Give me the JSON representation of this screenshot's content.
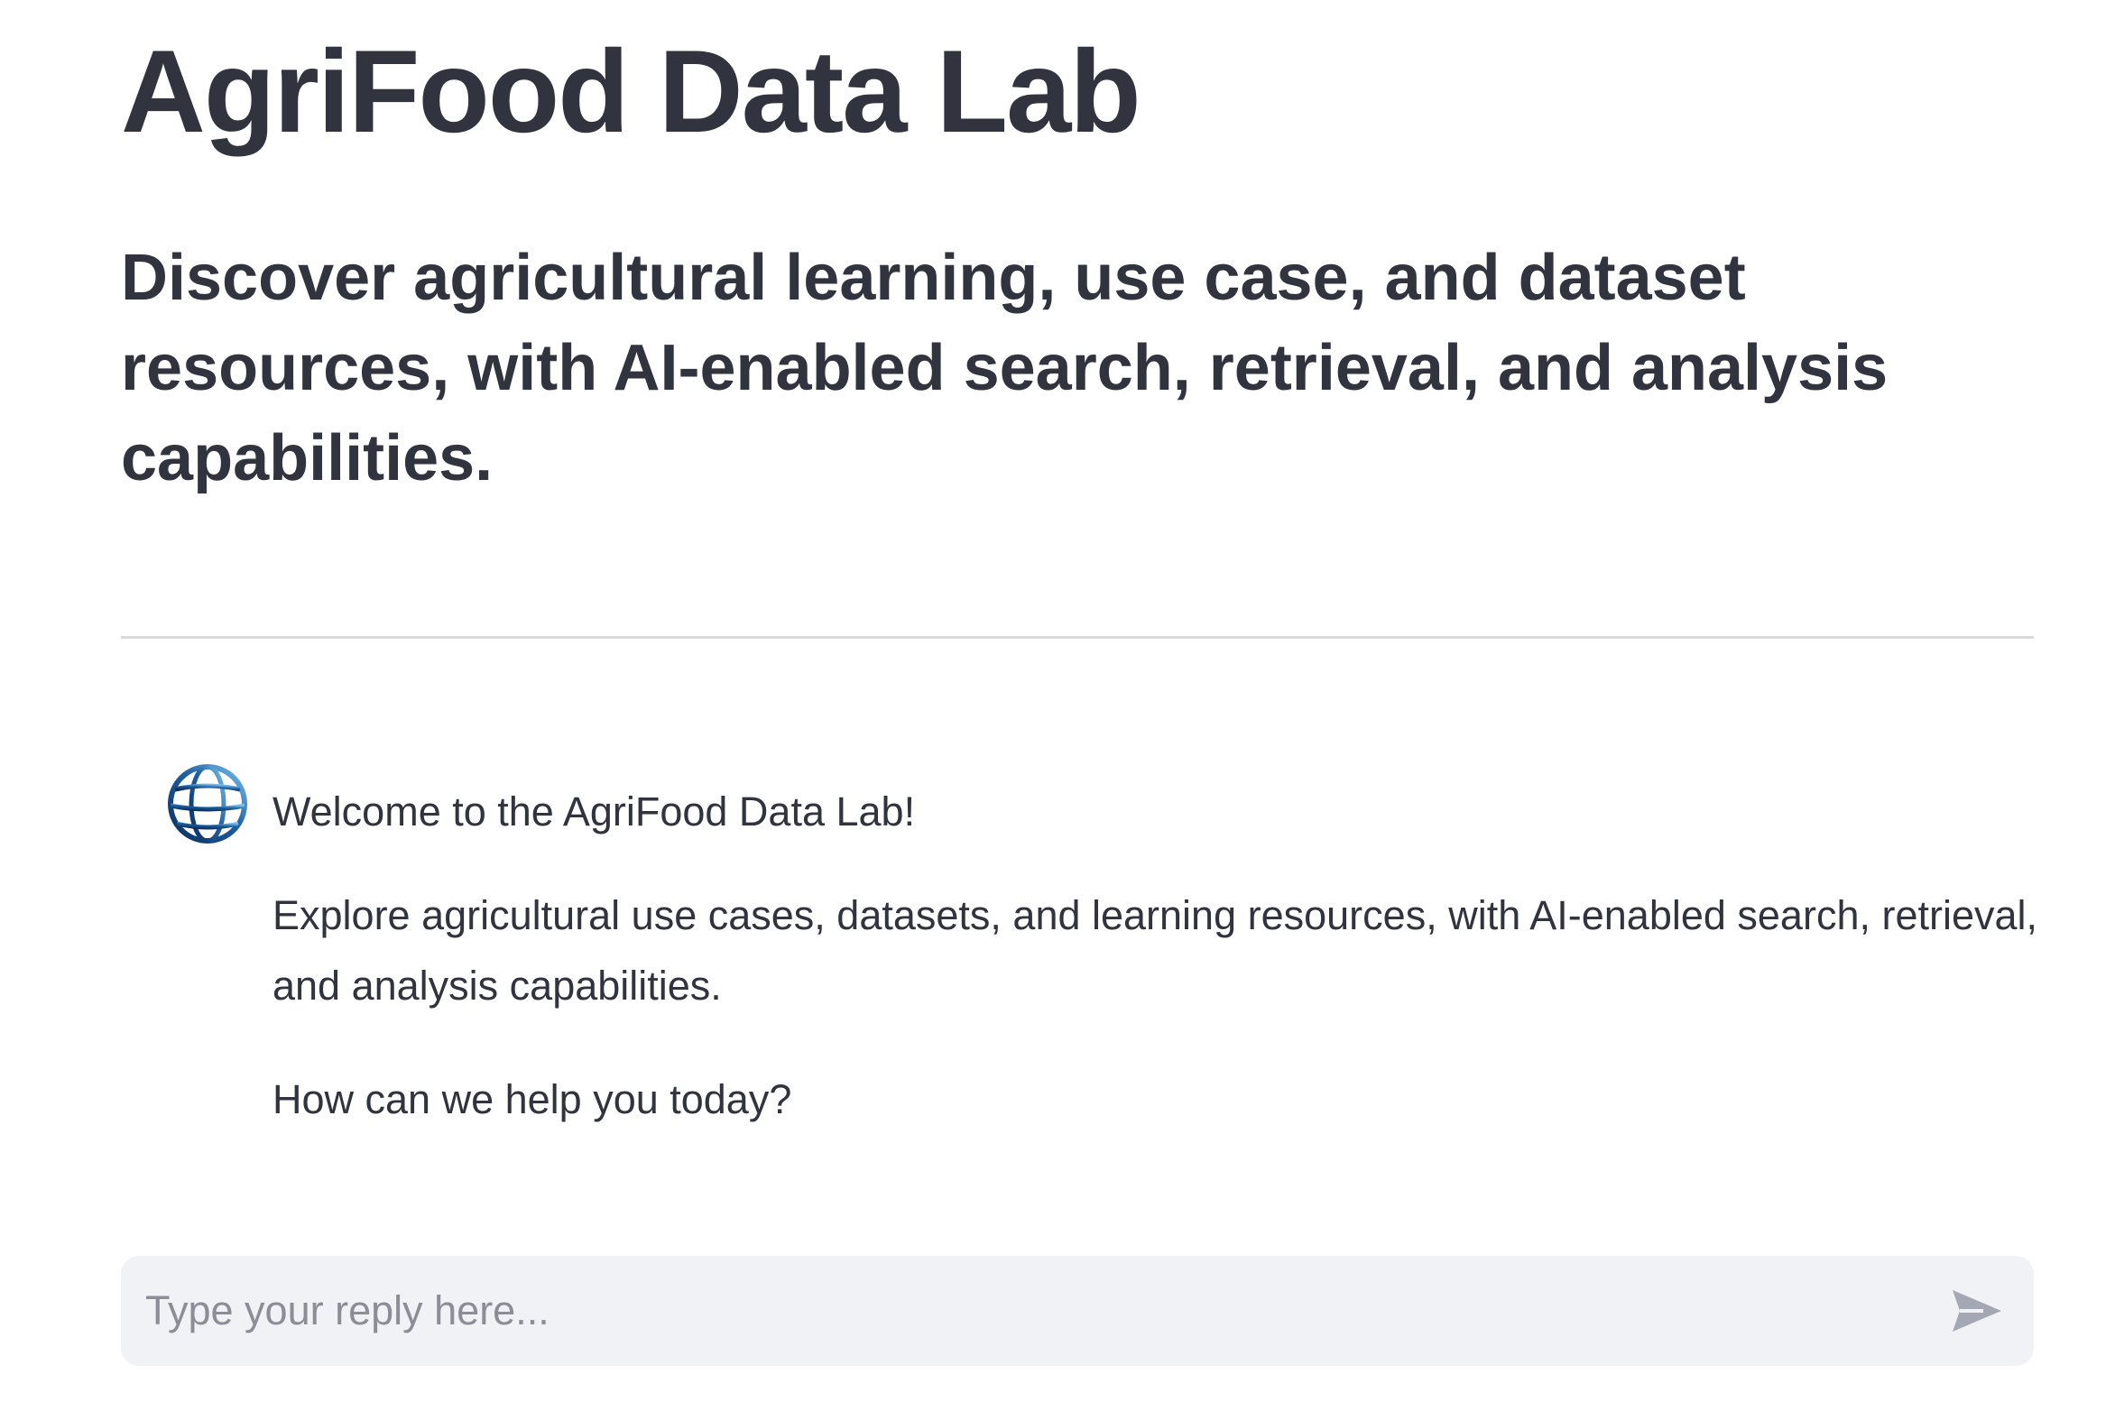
{
  "header": {
    "title": "AgriFood Data Lab",
    "subtitle": "Discover agricultural learning, use case, and dataset resources, with AI-enabled search, retrieval, and analysis capabilities."
  },
  "chat": {
    "assistant_avatar_icon": "globe-icon",
    "messages": [
      {
        "role": "assistant",
        "paragraphs": [
          "Welcome to the AgriFood Data Lab!",
          "Explore agricultural use cases, datasets, and learning resources, with AI-enabled search, retrieval, and analysis capabilities.",
          "How can we help you today?"
        ]
      }
    ],
    "input": {
      "value": "",
      "placeholder": "Type your reply here..."
    },
    "send_icon": "send-icon"
  },
  "colors": {
    "text": "#31333f",
    "divider": "#d9d9dc",
    "input_background": "#f0f2f6",
    "placeholder": "#8b8d97",
    "send_icon": "#a3a8b4",
    "globe_dark": "#0b2e5c",
    "globe_light": "#4aa3df"
  }
}
